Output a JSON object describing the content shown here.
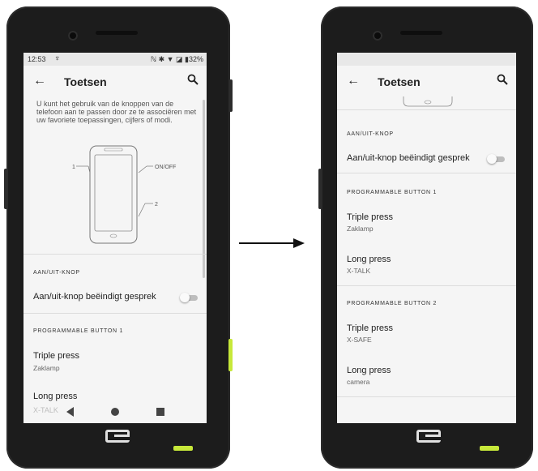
{
  "left": {
    "status": {
      "time": "12:53",
      "usb": "♆",
      "right": "ℕ ✱ ▼ ◪ ▮32%"
    },
    "appbar": {
      "back": "←",
      "title": "Toetsen"
    },
    "intro": "U kunt het gebruik van de knoppen van de telefoon aan te passen door ze te associëren met uw favoriete toepassingen, cijfers of modi.",
    "diagram_labels": {
      "one": "1",
      "onoff": "ON/OFF",
      "two": "2"
    },
    "sections": {
      "power": {
        "header": "AAN/UIT-KNOP",
        "row": "Aan/uit-knop beëindigt gesprek"
      },
      "button1": {
        "header": "PROGRAMMABLE BUTTON 1",
        "triple_title": "Triple press",
        "triple_sub": "Zaklamp",
        "long_title": "Long press",
        "long_sub": "X-TALK"
      }
    },
    "toggles": {
      "power_end_call": false
    }
  },
  "right": {
    "appbar": {
      "back": "←",
      "title": "Toetsen"
    },
    "sections": {
      "power": {
        "header": "AAN/UIT-KNOP",
        "row": "Aan/uit-knop beëindigt gesprek"
      },
      "button1": {
        "header": "PROGRAMMABLE BUTTON 1",
        "triple_title": "Triple press",
        "triple_sub": "Zaklamp",
        "long_title": "Long press",
        "long_sub": "X-TALK"
      },
      "button2": {
        "header": "PROGRAMMABLE BUTTON 2",
        "triple_title": "Triple press",
        "triple_sub": "X-SAFE",
        "long_title": "Long press",
        "long_sub": "camera"
      }
    },
    "toggles": {
      "power_end_call": false
    }
  },
  "icons": {
    "back": "arrow-left-icon",
    "search": "search-icon",
    "nav_back": "triangle-back-icon",
    "nav_home": "circle-home-icon",
    "nav_recent": "square-recent-icon",
    "brand": "crosscall-logo-icon"
  },
  "colors": {
    "screen_bg": "#f5f5f5",
    "phone_body": "#1c1c1c",
    "accent_button": "#c7e83a",
    "toggle_off": "#bdbdbd"
  }
}
